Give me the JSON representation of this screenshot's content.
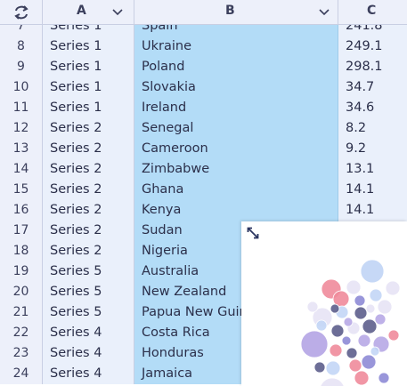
{
  "columns": {
    "a": {
      "letter": "A"
    },
    "b": {
      "letter": "B"
    },
    "c": {
      "letter": "C"
    }
  },
  "icons": {
    "corner": "swap-arrows-icon",
    "dropdown": "chevron-down-icon",
    "expand": "expand-arrows-icon"
  },
  "rows": [
    {
      "n": "7",
      "a": "Series 1",
      "b": "Spain",
      "c": "241.8"
    },
    {
      "n": "8",
      "a": "Series 1",
      "b": "Ukraine",
      "c": "249.1"
    },
    {
      "n": "9",
      "a": "Series 1",
      "b": "Poland",
      "c": "298.1"
    },
    {
      "n": "10",
      "a": "Series 1",
      "b": "Slovakia",
      "c": "34.7"
    },
    {
      "n": "11",
      "a": "Series 1",
      "b": "Ireland",
      "c": "34.6"
    },
    {
      "n": "12",
      "a": "Series 2",
      "b": "Senegal",
      "c": "8.2"
    },
    {
      "n": "13",
      "a": "Series 2",
      "b": "Cameroon",
      "c": "9.2"
    },
    {
      "n": "14",
      "a": "Series 2",
      "b": "Zimbabwe",
      "c": "13.1"
    },
    {
      "n": "15",
      "a": "Series 2",
      "b": "Ghana",
      "c": "14.1"
    },
    {
      "n": "16",
      "a": "Series 2",
      "b": "Kenya",
      "c": "14.1"
    },
    {
      "n": "17",
      "a": "Series 2",
      "b": "Sudan",
      "c": ""
    },
    {
      "n": "18",
      "a": "Series 2",
      "b": "Nigeria",
      "c": ""
    },
    {
      "n": "19",
      "a": "Series 5",
      "b": "Australia",
      "c": ""
    },
    {
      "n": "20",
      "a": "Series 5",
      "b": "New Zealand",
      "c": ""
    },
    {
      "n": "21",
      "a": "Series 5",
      "b": "Papua New Guinea",
      "c": ""
    },
    {
      "n": "22",
      "a": "Series 4",
      "b": "Costa Rica",
      "c": ""
    },
    {
      "n": "23",
      "a": "Series 4",
      "b": "Honduras",
      "c": ""
    },
    {
      "n": "24",
      "a": "Series 4",
      "b": "Jamaica",
      "c": ""
    }
  ],
  "colors": {
    "header_bg": "#edf0fa",
    "column_b_fill": "#b3dcf7",
    "bubble_palette": [
      "#b7a9e6",
      "#f08b9b",
      "#c3d6f6",
      "#e7e3f5",
      "#5d5e8c",
      "#8e8bd6"
    ]
  }
}
